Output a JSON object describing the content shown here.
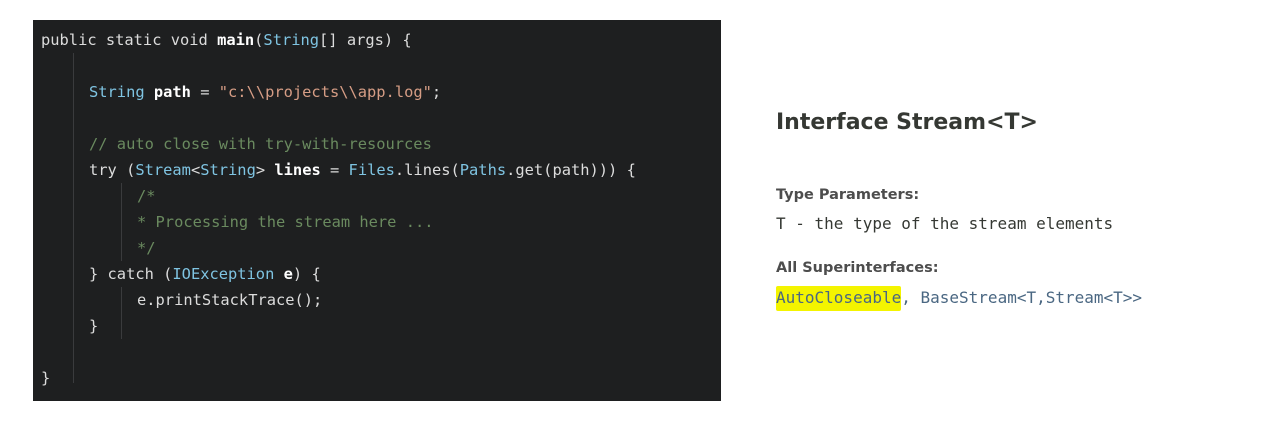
{
  "code": {
    "lines": [
      {
        "indent": 0,
        "parts": [
          {
            "t": "public static void ",
            "c": "kw"
          },
          {
            "t": "main",
            "c": "bold"
          },
          {
            "t": "(",
            "c": "kw"
          },
          {
            "t": "String",
            "c": "ty"
          },
          {
            "t": "[] args) {",
            "c": "kw"
          }
        ]
      },
      {
        "indent": 0,
        "parts": []
      },
      {
        "indent": 1,
        "parts": [
          {
            "t": "String ",
            "c": "ty"
          },
          {
            "t": "path",
            "c": "bold"
          },
          {
            "t": " = ",
            "c": "kw"
          },
          {
            "t": "\"c:\\\\projects\\\\app.log\"",
            "c": "str"
          },
          {
            "t": ";",
            "c": "kw"
          }
        ]
      },
      {
        "indent": 0,
        "parts": []
      },
      {
        "indent": 1,
        "parts": [
          {
            "t": "// auto close with try-with-resources",
            "c": "cm"
          }
        ]
      },
      {
        "indent": 1,
        "parts": [
          {
            "t": "try (",
            "c": "kw"
          },
          {
            "t": "Stream",
            "c": "ty"
          },
          {
            "t": "<",
            "c": "kw"
          },
          {
            "t": "String",
            "c": "ty"
          },
          {
            "t": "> ",
            "c": "kw"
          },
          {
            "t": "lines",
            "c": "bold"
          },
          {
            "t": " = ",
            "c": "kw"
          },
          {
            "t": "Files",
            "c": "ty"
          },
          {
            "t": ".lines(",
            "c": "kw"
          },
          {
            "t": "Paths",
            "c": "ty"
          },
          {
            "t": ".get(path))) {",
            "c": "kw"
          }
        ]
      },
      {
        "indent": 2,
        "parts": [
          {
            "t": "/*",
            "c": "cm"
          }
        ]
      },
      {
        "indent": 2,
        "parts": [
          {
            "t": "* Processing the stream here ...",
            "c": "cm"
          }
        ]
      },
      {
        "indent": 2,
        "parts": [
          {
            "t": "*/",
            "c": "cm"
          }
        ]
      },
      {
        "indent": 1,
        "parts": [
          {
            "t": "} catch (",
            "c": "kw"
          },
          {
            "t": "IOException",
            "c": "ty"
          },
          {
            "t": " ",
            "c": "kw"
          },
          {
            "t": "e",
            "c": "bold"
          },
          {
            "t": ") {",
            "c": "kw"
          }
        ]
      },
      {
        "indent": 2,
        "parts": [
          {
            "t": "e.printStackTrace();",
            "c": "kw"
          }
        ]
      },
      {
        "indent": 1,
        "parts": [
          {
            "t": "}",
            "c": "kw"
          }
        ]
      },
      {
        "indent": 0,
        "parts": []
      },
      {
        "indent": 0,
        "parts": [
          {
            "t": "}",
            "c": "kw"
          }
        ]
      }
    ]
  },
  "doc": {
    "title": "Interface Stream<T>",
    "type_params_label": "Type Parameters:",
    "type_params_value": "T - the type of the stream elements",
    "superinterfaces_label": "All Superinterfaces:",
    "superinterface_highlighted": "AutoCloseable",
    "superinterfaces_rest": ", BaseStream<T,Stream<T>>"
  },
  "colors": {
    "editor_bg": "#1e1f20",
    "highlight": "#f4f400"
  }
}
